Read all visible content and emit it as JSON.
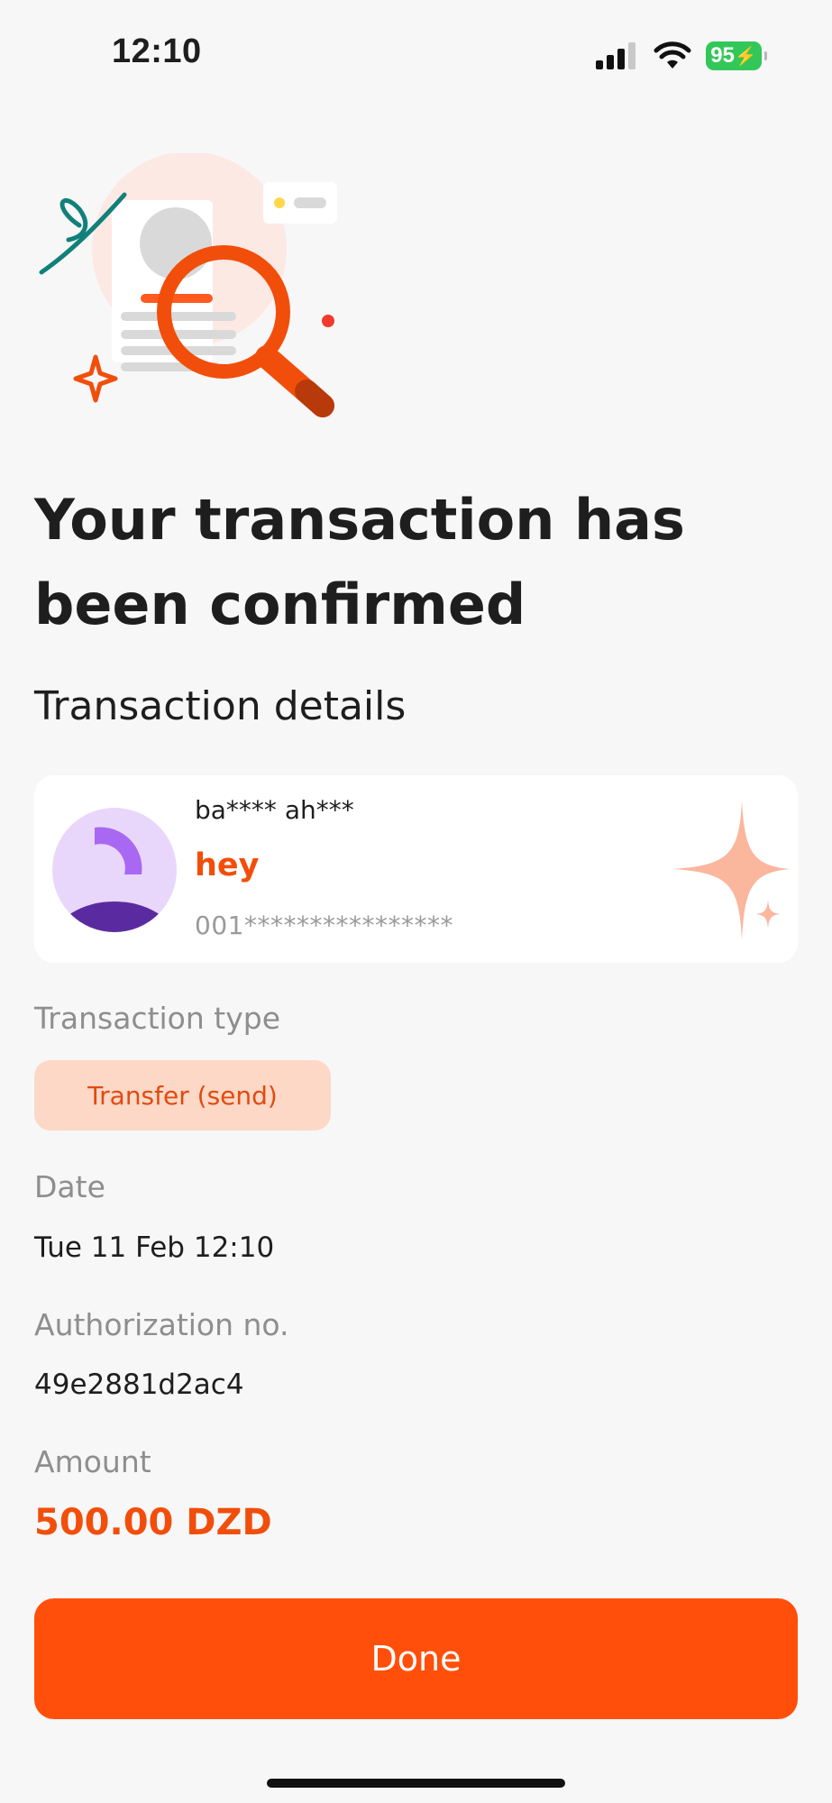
{
  "status_bar": {
    "time": "12:10",
    "battery": "95",
    "icons": [
      "cellular-signal-icon",
      "wifi-icon",
      "battery-charging-icon"
    ]
  },
  "confirmation": {
    "headline": "Your transaction has been confirmed",
    "section_title": "Transaction details"
  },
  "recipient": {
    "name": "ba**** ah***",
    "label": "hey",
    "account": "001****************"
  },
  "transaction": {
    "type_label": "Transaction type",
    "type_value": "Transfer (send)",
    "date_label": "Date",
    "date_value": "Tue 11 Feb 12:10",
    "auth_label": "Authorization no.",
    "auth_value": "49e2881d2ac4",
    "amount_label": "Amount",
    "amount_value": "500.00 DZD"
  },
  "actions": {
    "done_label": "Done"
  },
  "colors": {
    "accent": "#ff4f0a",
    "accent_text": "#f24e0b",
    "chip_background": "#fdd8c7",
    "background": "#f7f7f7"
  }
}
